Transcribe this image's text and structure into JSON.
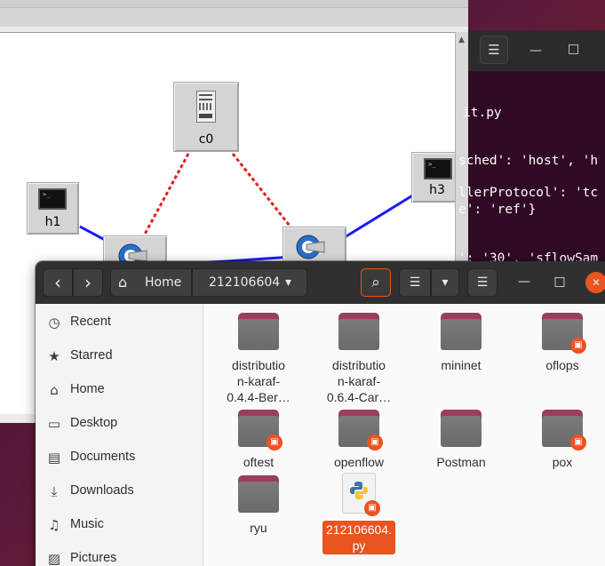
{
  "mininet": {
    "nodes": {
      "controller": "c0",
      "host1": "h1",
      "host3": "h3"
    },
    "term_prompt_glyph": ">_"
  },
  "terminal": {
    "menu_glyph": "☰",
    "minimize_glyph": "—",
    "maximize_glyph": "□",
    "lines": [
      "it.py",
      "sched': 'host', 'h",
      "llerProtocol': 'tc",
      "e': 'ref'}",
      "': '30', 'sflowSam"
    ]
  },
  "files": {
    "header": {
      "back_glyph": "‹",
      "forward_glyph": "›",
      "home_label": "Home",
      "path_label": "212106604",
      "path_menu_glyph": "▾",
      "search_glyph": "⌕",
      "list_view_glyph": "☰",
      "view_menu_glyph": "▾",
      "main_menu_glyph": "☰",
      "minimize_glyph": "—",
      "maximize_glyph": "□",
      "close_glyph": "✕"
    },
    "sidebar": [
      {
        "label": "Recent",
        "icon": "clock-icon",
        "glyph": "◷"
      },
      {
        "label": "Starred",
        "icon": "star-icon",
        "glyph": "★"
      },
      {
        "label": "Home",
        "icon": "home-icon",
        "glyph": "⌂"
      },
      {
        "label": "Desktop",
        "icon": "desktop-icon",
        "glyph": "▭"
      },
      {
        "label": "Documents",
        "icon": "documents-icon",
        "glyph": "▤"
      },
      {
        "label": "Downloads",
        "icon": "downloads-icon",
        "glyph": "⤓"
      },
      {
        "label": "Music",
        "icon": "music-icon",
        "glyph": "♫"
      },
      {
        "label": "Pictures",
        "icon": "pictures-icon",
        "glyph": "▨"
      }
    ],
    "items": [
      {
        "name": "distributio\nn-karaf-\n0.4.4-Ber…",
        "locked": false
      },
      {
        "name": "distributio\nn-karaf-\n0.6.4-Car…",
        "locked": false
      },
      {
        "name": "mininet",
        "locked": false
      },
      {
        "name": "oflops",
        "locked": true
      },
      {
        "name": "oftest",
        "locked": true
      },
      {
        "name": "openflow",
        "locked": true
      },
      {
        "name": "Postman",
        "locked": false
      },
      {
        "name": "pox",
        "locked": true
      },
      {
        "name": "ryu",
        "locked": false
      },
      {
        "name": "212106604.\npy",
        "locked": true,
        "selected": true,
        "type": "python"
      }
    ],
    "lock_glyph": "🔒"
  },
  "colors": {
    "accent": "#e95420",
    "folder_tab": "#9c3d5f",
    "terminal_bg": "#300a24",
    "link_controller": "#e02020",
    "link_switch": "#1a1aff"
  }
}
